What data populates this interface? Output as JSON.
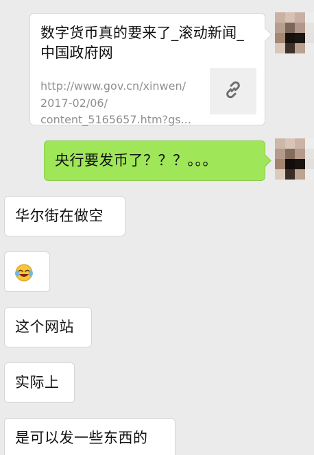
{
  "conversation": {
    "link_card": {
      "title": "数字货币真的要来了_滚动新闻_中国政府网",
      "url": "http://www.gov.cn/xinwen/\n2017-02/06/\ncontent_5165657.htm?gs...",
      "thumb_icon": "link-icon"
    },
    "outgoing": [
      {
        "text": "央行要发币了？？？。。。"
      }
    ],
    "incoming": [
      {
        "text": "华尔街在做空"
      },
      {
        "emoji": "tears-of-joy-emoji"
      },
      {
        "text": "这个网站"
      },
      {
        "text": "实际上"
      },
      {
        "text": "是可以发一些东西的"
      }
    ]
  },
  "colors": {
    "background": "#ebebeb",
    "outgoing_bubble": "#9fe658",
    "incoming_bubble": "#ffffff",
    "url_text": "#8f8f8f"
  }
}
